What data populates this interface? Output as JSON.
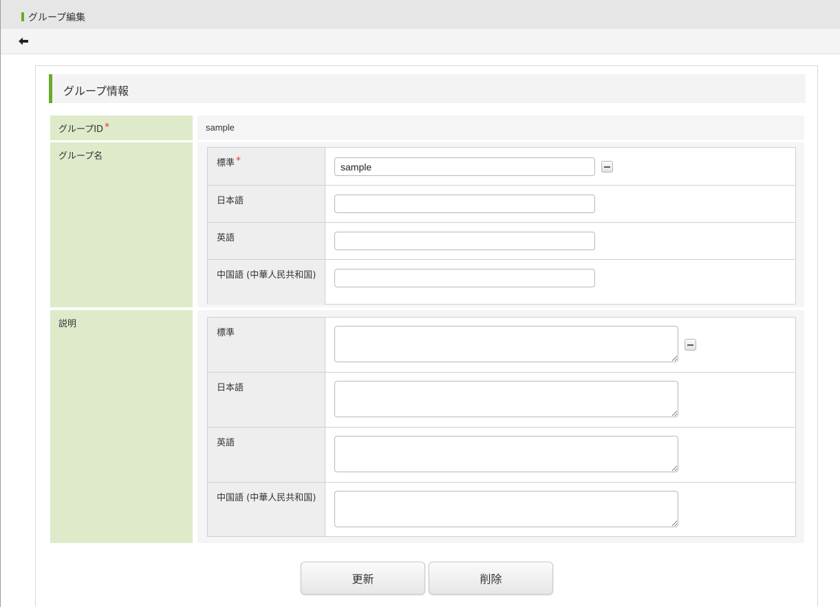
{
  "window": {
    "title": "グループ編集"
  },
  "toolbar": {
    "back_icon": "arrow-left-icon"
  },
  "section": {
    "title": "グループ情報"
  },
  "group_id": {
    "label": "グループID",
    "required_mark": "*",
    "value": "sample"
  },
  "group_name": {
    "label": "グループ名",
    "rows": [
      {
        "label": "標準",
        "required_mark": "*",
        "value": "sample"
      },
      {
        "label": "日本語",
        "value": ""
      },
      {
        "label": "英語",
        "value": ""
      },
      {
        "label": "中国語 (中華人民共和国)",
        "value": ""
      }
    ]
  },
  "description": {
    "label": "説明",
    "rows": [
      {
        "label": "標準",
        "value": ""
      },
      {
        "label": "日本語",
        "value": ""
      },
      {
        "label": "英語",
        "value": ""
      },
      {
        "label": "中国語 (中華人民共和国)",
        "value": ""
      }
    ]
  },
  "buttons": {
    "update": "更新",
    "delete": "削除"
  },
  "colors": {
    "accent": "#6aaa2a",
    "label_bg": "#deeac9",
    "required": "#e23b3b"
  }
}
